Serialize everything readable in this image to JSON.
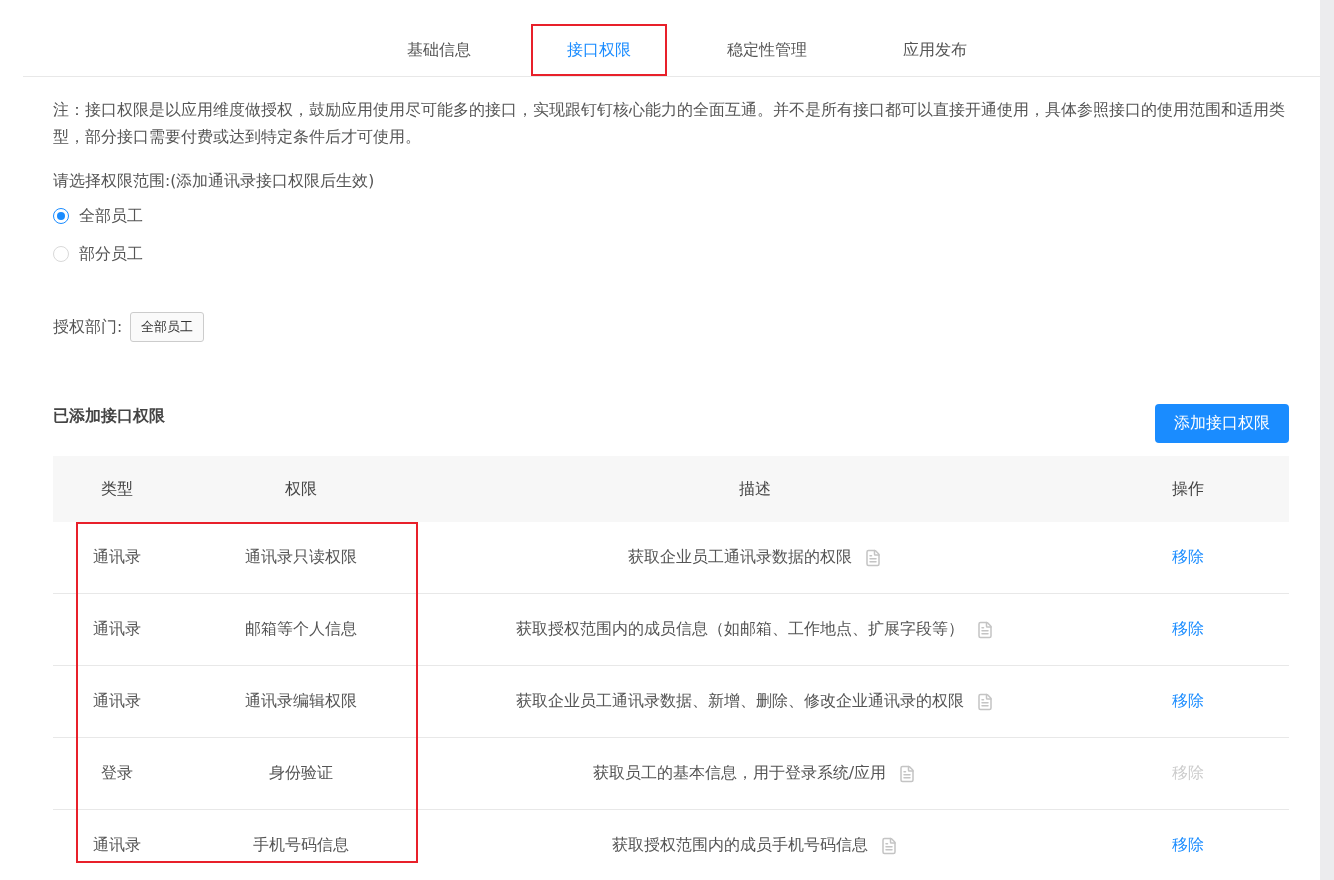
{
  "tabs": [
    {
      "label": "基础信息",
      "selected": false,
      "highlighted": false
    },
    {
      "label": "接口权限",
      "selected": true,
      "highlighted": true
    },
    {
      "label": "稳定性管理",
      "selected": false,
      "highlighted": false
    },
    {
      "label": "应用发布",
      "selected": false,
      "highlighted": false
    }
  ],
  "note": "注：接口权限是以应用维度做授权，鼓励应用使用尽可能多的接口，实现跟钉钉核心能力的全面互通。并不是所有接口都可以直接开通使用，具体参照接口的使用范围和适用类型，部分接口需要付费或达到特定条件后才可使用。",
  "scope": {
    "label": "请选择权限范围:(添加通讯录接口权限后生效)",
    "options": [
      {
        "label": "全部员工",
        "selected": true
      },
      {
        "label": "部分员工",
        "selected": false
      }
    ]
  },
  "department": {
    "label": "授权部门:",
    "tags": [
      "全部员工"
    ]
  },
  "section": {
    "title": "已添加接口权限",
    "add_button": "添加接口权限"
  },
  "table": {
    "columns": [
      "类型",
      "权限",
      "描述",
      "操作"
    ],
    "highlight_first_columns": true,
    "rows": [
      {
        "type": "通讯录",
        "permission": "通讯录只读权限",
        "description": "获取企业员工通讯录数据的权限",
        "action": "移除",
        "disabled": false
      },
      {
        "type": "通讯录",
        "permission": "邮箱等个人信息",
        "description": "获取授权范围内的成员信息（如邮箱、工作地点、扩展字段等）",
        "action": "移除",
        "disabled": false
      },
      {
        "type": "通讯录",
        "permission": "通讯录编辑权限",
        "description": "获取企业员工通讯录数据、新增、删除、修改企业通讯录的权限",
        "action": "移除",
        "disabled": false
      },
      {
        "type": "登录",
        "permission": "身份验证",
        "description": "获取员工的基本信息，用于登录系统/应用",
        "action": "移除",
        "disabled": true
      },
      {
        "type": "通讯录",
        "permission": "手机号码信息",
        "description": "获取授权范围内的成员手机号码信息",
        "action": "移除",
        "disabled": false
      }
    ]
  }
}
